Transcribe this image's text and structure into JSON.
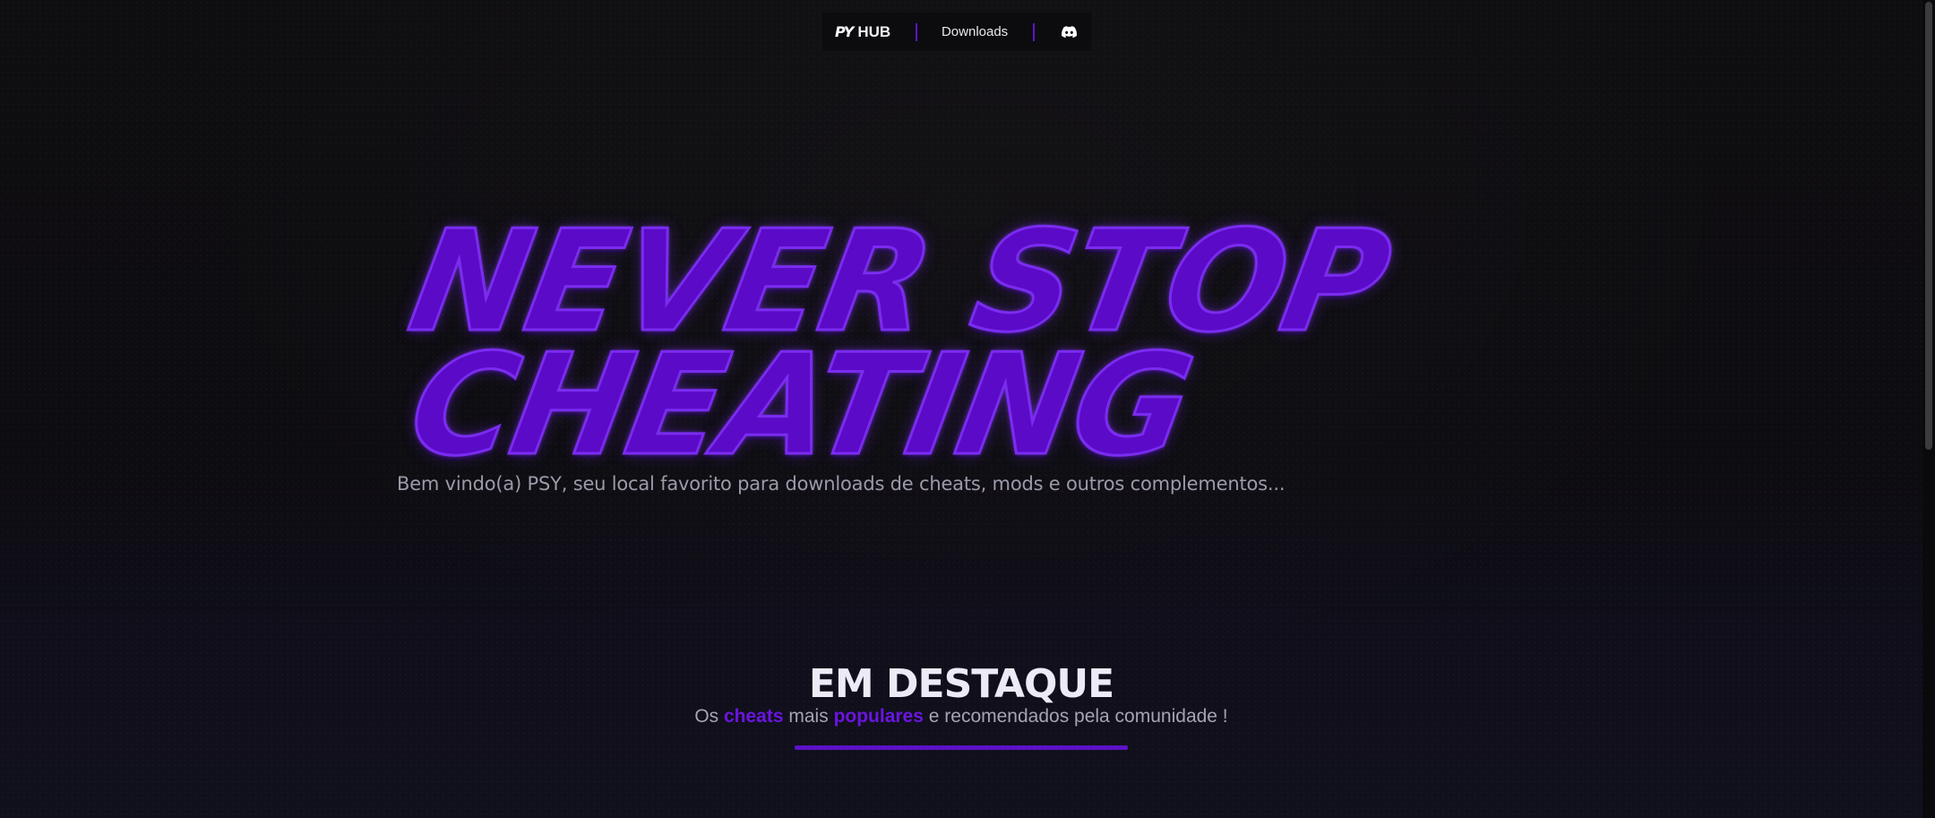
{
  "nav": {
    "brand_mark": "PY",
    "brand_label": "HUB",
    "downloads_label": "Downloads",
    "discord_icon": "discord-icon"
  },
  "hero": {
    "line1": "NEVER STOP",
    "line2": "CHEATING",
    "subtitle": "Bem vindo(a) PSY, seu local favorito para downloads de cheats, mods e outros complementos..."
  },
  "featured": {
    "title": "EM DESTAQUE",
    "sub_part1": "Os ",
    "sub_accent1": "cheats",
    "sub_part2": " mais ",
    "sub_accent2": "populares",
    "sub_part3": " e recomendados pela comunidade !"
  },
  "colors": {
    "accent": "#5b0ac7",
    "background": "#0d0c10",
    "text_muted": "#9d9aaa"
  }
}
